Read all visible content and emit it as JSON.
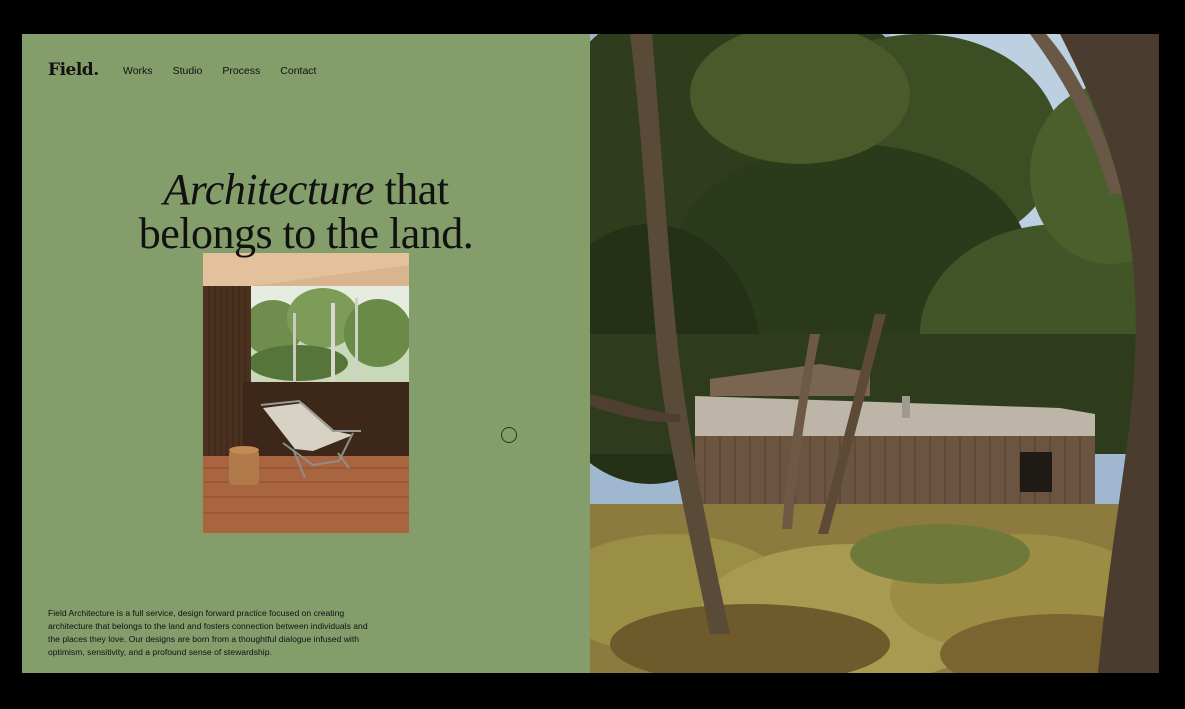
{
  "brand": {
    "logo": "Field."
  },
  "nav": {
    "items": [
      "Works",
      "Studio",
      "Process",
      "Contact"
    ]
  },
  "hero": {
    "headline_italic": "Architecture",
    "headline_rest_line1": " that",
    "headline_line2": "belongs to the land."
  },
  "about": {
    "text": "Field Architecture is a full service, design forward practice focused on creating architecture that belongs to the land and fosters connection between individuals and the places they love. Our designs are born from a thoughtful dialogue infused with optimism, sensitivity, and a profound sense of stewardship."
  },
  "colors": {
    "panel_green": "#849e6b",
    "background": "#000000",
    "text": "#111111"
  }
}
